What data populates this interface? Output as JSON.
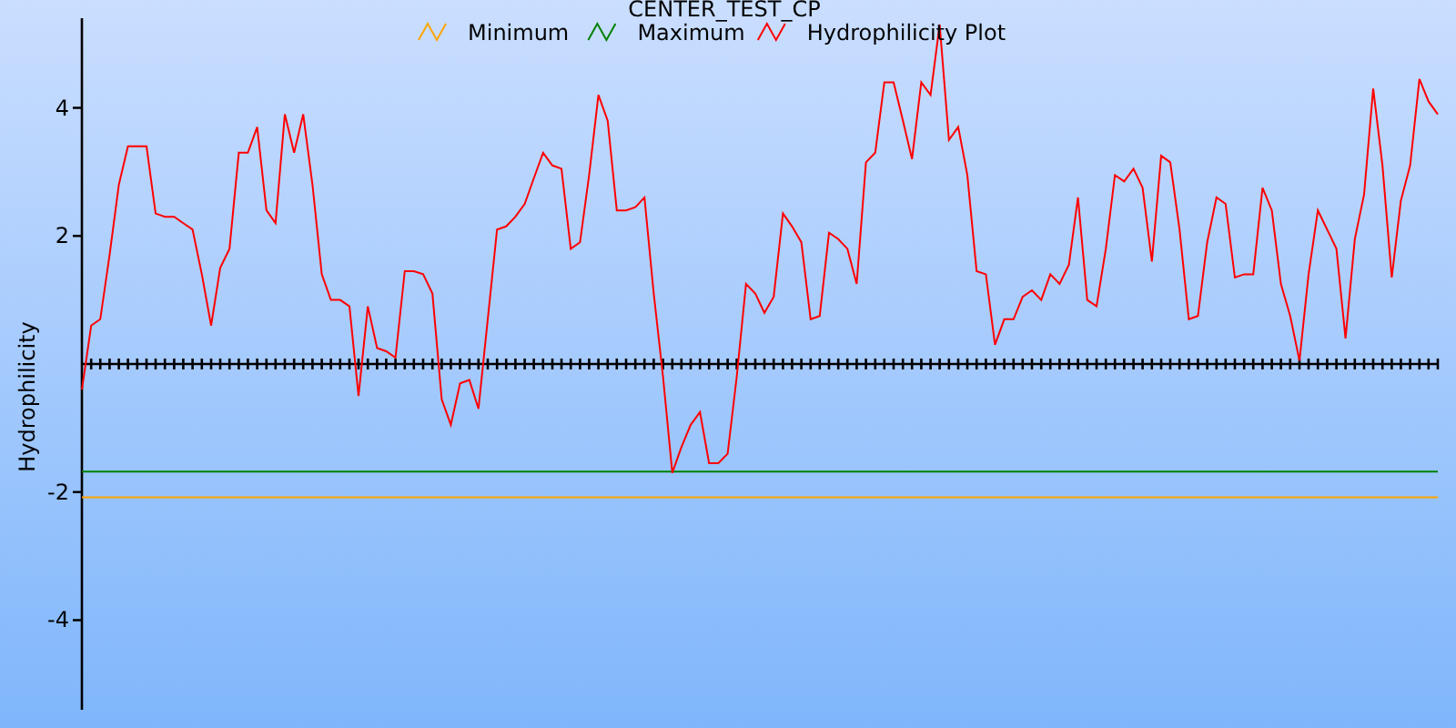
{
  "chart_data": {
    "type": "line",
    "title": "CENTER_TEST_CP",
    "ylabel": "Hydrophilicity",
    "legend": "top",
    "ylim": [
      -5.4,
      5.4
    ],
    "yticks": [
      4,
      2,
      -2,
      -4
    ],
    "series": [
      {
        "name": "Minimum",
        "color": "#ffa500",
        "values": [
          -2.08,
          -2.08,
          -2.08,
          -2.08,
          -2.08,
          -2.08,
          -2.08,
          -2.08,
          -2.08,
          -2.08,
          -2.08,
          -2.08,
          -2.08,
          -2.08,
          -2.08,
          -2.08,
          -2.08,
          -2.08,
          -2.08,
          -2.08,
          -2.08,
          -2.08,
          -2.08,
          -2.08,
          -2.08,
          -2.08,
          -2.08,
          -2.08,
          -2.08,
          -2.08,
          -2.08,
          -2.08,
          -2.08,
          -2.08,
          -2.08,
          -2.08,
          -2.08,
          -2.08,
          -2.08,
          -2.08,
          -2.08,
          -2.08,
          -2.08,
          -2.08,
          -2.08,
          -2.08,
          -2.08,
          -2.08,
          -2.08,
          -2.08,
          -2.08,
          -2.08,
          -2.08,
          -2.08,
          -2.08,
          -2.08,
          -2.08,
          -2.08,
          -2.08,
          -2.08,
          -2.08,
          -2.08,
          -2.08,
          -2.08,
          -2.08,
          -2.08,
          -2.08,
          -2.08,
          -2.08,
          -2.08,
          -2.08,
          -2.08,
          -2.08,
          -2.08,
          -2.08,
          -2.08,
          -2.08,
          -2.08,
          -2.08,
          -2.08,
          -2.08,
          -2.08,
          -2.08,
          -2.08,
          -2.08,
          -2.08,
          -2.08,
          -2.08,
          -2.08,
          -2.08,
          -2.08,
          -2.08,
          -2.08,
          -2.08,
          -2.08,
          -2.08,
          -2.08,
          -2.08,
          -2.08,
          -2.08,
          -2.08,
          -2.08,
          -2.08,
          -2.08,
          -2.08,
          -2.08,
          -2.08,
          -2.08,
          -2.08,
          -2.08,
          -2.08,
          -2.08,
          -2.08,
          -2.08,
          -2.08,
          -2.08,
          -2.08,
          -2.08,
          -2.08,
          -2.08,
          -2.08,
          -2.08,
          -2.08,
          -2.08,
          -2.08,
          -2.08,
          -2.08,
          -2.08,
          -2.08,
          -2.08,
          -2.08,
          -2.08,
          -2.08,
          -2.08,
          -2.08,
          -2.08,
          -2.08,
          -2.08,
          -2.08,
          -2.08,
          -2.08,
          -2.08,
          -2.08,
          -2.08,
          -2.08,
          -2.08,
          -2.08,
          -2.08
        ]
      },
      {
        "name": "Maximum",
        "color": "#008000",
        "values": [
          -1.68,
          -1.68,
          -1.68,
          -1.68,
          -1.68,
          -1.68,
          -1.68,
          -1.68,
          -1.68,
          -1.68,
          -1.68,
          -1.68,
          -1.68,
          -1.68,
          -1.68,
          -1.68,
          -1.68,
          -1.68,
          -1.68,
          -1.68,
          -1.68,
          -1.68,
          -1.68,
          -1.68,
          -1.68,
          -1.68,
          -1.68,
          -1.68,
          -1.68,
          -1.68,
          -1.68,
          -1.68,
          -1.68,
          -1.68,
          -1.68,
          -1.68,
          -1.68,
          -1.68,
          -1.68,
          -1.68,
          -1.68,
          -1.68,
          -1.68,
          -1.68,
          -1.68,
          -1.68,
          -1.68,
          -1.68,
          -1.68,
          -1.68,
          -1.68,
          -1.68,
          -1.68,
          -1.68,
          -1.68,
          -1.68,
          -1.68,
          -1.68,
          -1.68,
          -1.68,
          -1.68,
          -1.68,
          -1.68,
          -1.68,
          -1.68,
          -1.68,
          -1.68,
          -1.68,
          -1.68,
          -1.68,
          -1.68,
          -1.68,
          -1.68,
          -1.68,
          -1.68,
          -1.68,
          -1.68,
          -1.68,
          -1.68,
          -1.68,
          -1.68,
          -1.68,
          -1.68,
          -1.68,
          -1.68,
          -1.68,
          -1.68,
          -1.68,
          -1.68,
          -1.68,
          -1.68,
          -1.68,
          -1.68,
          -1.68,
          -1.68,
          -1.68,
          -1.68,
          -1.68,
          -1.68,
          -1.68,
          -1.68,
          -1.68,
          -1.68,
          -1.68,
          -1.68,
          -1.68,
          -1.68,
          -1.68,
          -1.68,
          -1.68,
          -1.68,
          -1.68,
          -1.68,
          -1.68,
          -1.68,
          -1.68,
          -1.68,
          -1.68,
          -1.68,
          -1.68,
          -1.68,
          -1.68,
          -1.68,
          -1.68,
          -1.68,
          -1.68,
          -1.68,
          -1.68,
          -1.68,
          -1.68,
          -1.68,
          -1.68,
          -1.68,
          -1.68,
          -1.68,
          -1.68,
          -1.68,
          -1.68,
          -1.68,
          -1.68,
          -1.68,
          -1.68,
          -1.68,
          -1.68,
          -1.68,
          -1.68,
          -1.68,
          -1.68
        ]
      },
      {
        "name": "Hydrophilicity Plot",
        "color": "#ff0000",
        "values": [
          -0.4,
          0.6,
          0.7,
          1.7,
          2.8,
          3.4,
          3.4,
          3.4,
          2.35,
          2.3,
          2.3,
          2.2,
          2.1,
          1.4,
          0.6,
          1.5,
          1.8,
          3.3,
          3.3,
          3.7,
          2.4,
          2.2,
          3.9,
          3.3,
          3.9,
          2.8,
          1.4,
          1.0,
          1.0,
          0.9,
          -0.5,
          0.9,
          0.25,
          0.2,
          0.1,
          1.45,
          1.45,
          1.4,
          1.1,
          -0.55,
          -0.95,
          -0.3,
          -0.25,
          -0.7,
          0.7,
          2.1,
          2.15,
          2.3,
          2.5,
          2.9,
          3.3,
          3.1,
          3.05,
          1.8,
          1.9,
          2.95,
          4.2,
          3.8,
          2.4,
          2.4,
          2.45,
          2.6,
          1.1,
          -0.2,
          -1.7,
          -1.3,
          -0.95,
          -0.75,
          -1.55,
          -1.55,
          -1.4,
          -0.2,
          1.25,
          1.1,
          0.8,
          1.05,
          2.35,
          2.15,
          1.9,
          0.7,
          0.75,
          2.05,
          1.95,
          1.8,
          1.25,
          3.15,
          3.3,
          4.4,
          4.4,
          3.8,
          3.2,
          4.4,
          4.2,
          5.3,
          3.5,
          3.7,
          2.95,
          1.45,
          1.4,
          0.3,
          0.7,
          0.7,
          1.05,
          1.15,
          1.0,
          1.4,
          1.25,
          1.55,
          2.6,
          1.0,
          0.9,
          1.8,
          2.95,
          2.85,
          3.05,
          2.75,
          1.6,
          3.25,
          3.15,
          2.1,
          0.7,
          0.75,
          1.9,
          2.6,
          2.5,
          1.35,
          1.4,
          1.4,
          2.75,
          2.4,
          1.25,
          0.75,
          0.05,
          1.4,
          2.4,
          2.1,
          1.8,
          0.4,
          1.95,
          2.65,
          4.3,
          3.1,
          1.35,
          2.55,
          3.1,
          4.45,
          4.1,
          3.9
        ]
      }
    ]
  }
}
